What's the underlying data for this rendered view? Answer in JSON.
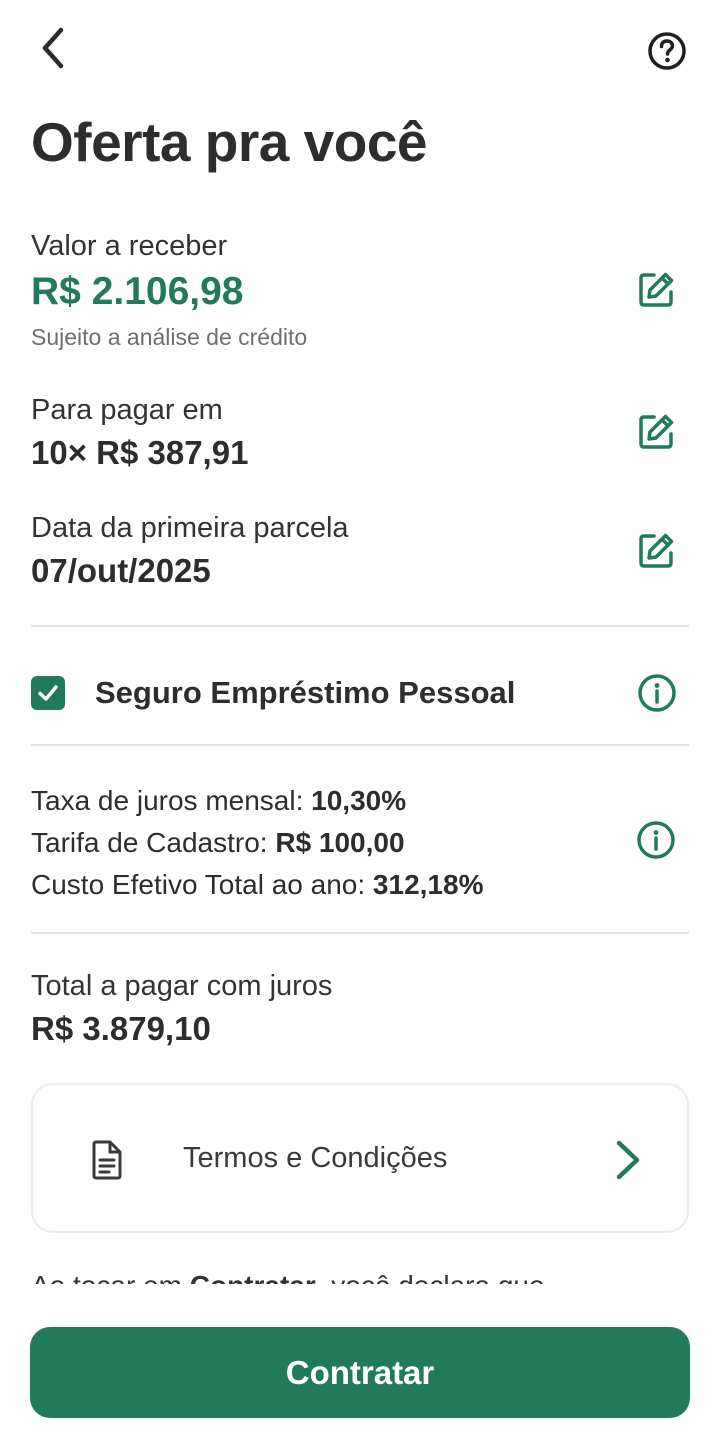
{
  "header": {
    "title": "Oferta pra você",
    "back_icon": "chevron-left-icon",
    "help_icon": "help-circle-icon"
  },
  "offer": {
    "amount": {
      "label": "Valor a receber",
      "value": "R$ 2.106,98",
      "note": "Sujeito a análise de crédito"
    },
    "installments": {
      "label": "Para pagar em",
      "value": "10× R$ 387,91"
    },
    "first_due": {
      "label": "Data da primeira parcela",
      "value": "07/out/2025"
    }
  },
  "insurance": {
    "label": "Seguro Empréstimo Pessoal",
    "checked": true
  },
  "rates": {
    "monthly_label": "Taxa de juros mensal: ",
    "monthly_value": "10,30%",
    "fee_label": "Tarifa de Cadastro: ",
    "fee_value": "R$ 100,00",
    "cet_label": "Custo Efetivo Total ao ano: ",
    "cet_value": "312,18%"
  },
  "total": {
    "label": "Total a pagar com juros",
    "value": "R$ 3.879,10"
  },
  "terms": {
    "label": "Termos e Condições"
  },
  "declaration": {
    "prefix": "Ao tocar em ",
    "emphasis": "Contratar",
    "suffix": ", você declara que"
  },
  "cta": {
    "label": "Contratar"
  },
  "colors": {
    "brand_green": "#217a5a",
    "text_dark": "#2d2d2d",
    "muted": "#6e6e6e",
    "divider": "#e3e3e3"
  }
}
